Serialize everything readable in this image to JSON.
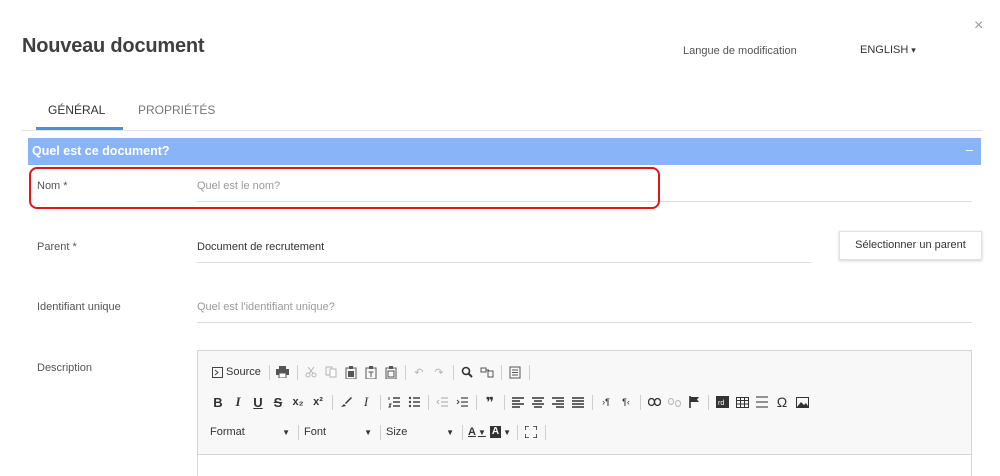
{
  "modal": {
    "title": "Nouveau document",
    "close_glyph": "×",
    "language_label": "Langue de modification",
    "language_value": "ENGLISH",
    "language_caret": "▾"
  },
  "tabs": [
    {
      "label": "GÉNÉRAL",
      "active": true
    },
    {
      "label": "PROPRIÉTÉS",
      "active": false
    }
  ],
  "section": {
    "title": "Quel est ce document?",
    "toggle": "–",
    "header_color": "#8ab4f8"
  },
  "fields": {
    "name": {
      "label": "Nom *",
      "value": "",
      "placeholder": "Quel est le nom?"
    },
    "parent": {
      "label": "Parent  *",
      "value": "Document de recrutement",
      "button": "Sélectionner un parent"
    },
    "identifier": {
      "label": "Identifiant unique",
      "value": "",
      "placeholder": "Quel est l'identifiant unique?"
    },
    "description": {
      "label": "Description"
    }
  },
  "editor": {
    "source_label": "Source",
    "format_label": "Format",
    "font_label": "Font",
    "size_label": "Size",
    "text_color_label": "A",
    "bg_color_label": "A",
    "icons_row1": [
      "source-icon",
      "print-icon",
      "cut-icon",
      "copy-icon",
      "paste-icon",
      "paste-text-icon",
      "paste-word-icon",
      "undo-icon",
      "redo-icon",
      "find-icon",
      "replace-icon",
      "select-all-icon"
    ],
    "icons_row2": [
      "bold-icon",
      "italic-icon",
      "underline-icon",
      "strike-icon",
      "subscript-icon",
      "superscript-icon",
      "remove-format-brush-icon",
      "clear-format-icon",
      "numbered-list-icon",
      "bulleted-list-icon",
      "outdent-icon",
      "indent-icon",
      "blockquote-icon",
      "align-left-icon",
      "align-center-icon",
      "align-right-icon",
      "justify-icon",
      "ltr-icon",
      "rtl-icon",
      "link-icon",
      "unlink-icon",
      "anchor-icon",
      "embed-icon",
      "table-icon",
      "horizontal-rule-icon",
      "special-char-icon",
      "image-icon"
    ],
    "icons_row3": [
      "format-dropdown",
      "font-dropdown",
      "size-dropdown",
      "text-color-icon",
      "bg-color-icon",
      "maximize-icon"
    ],
    "glyphs": {
      "bold": "B",
      "italic": "I",
      "underline": "U",
      "strike": "S",
      "subscript": "x₂",
      "superscript": "x²",
      "clear_format": "I",
      "blockquote": "❞",
      "omega": "Ω",
      "find": "⌕",
      "undo": "↶",
      "redo": "↷"
    }
  },
  "colors": {
    "accent": "#4a90d9",
    "highlight_border": "#e0161b"
  }
}
